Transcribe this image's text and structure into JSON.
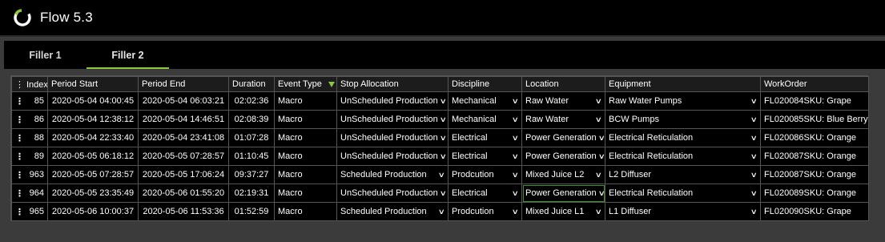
{
  "app": {
    "title": "Flow 5.3",
    "accent": "#8dc63f"
  },
  "tabs": [
    {
      "label": "Filler 1",
      "active": false
    },
    {
      "label": "Filler 2",
      "active": true
    }
  ],
  "grid": {
    "columns": [
      "Index",
      "Period Start",
      "Period End",
      "Duration",
      "Event Type",
      "Stop Allocation",
      "Discipline",
      "Location",
      "Equipment",
      "WorkOrder"
    ],
    "row_menu_glyph": "⋮",
    "rows": [
      {
        "index": "85",
        "start": "2020-05-04 04:00:45",
        "end": "2020-05-04 06:03:21",
        "duration": "02:02:36",
        "event": "Macro",
        "stop": "UnScheduled Production",
        "discipline": "Mechanical",
        "location": "Raw Water",
        "equipment": "Raw Water Pumps",
        "workorder": "FL020084SKU: Grape"
      },
      {
        "index": "86",
        "start": "2020-05-04 12:38:12",
        "end": "2020-05-04 14:46:51",
        "duration": "02:08:39",
        "event": "Macro",
        "stop": "UnScheduled Production",
        "discipline": "Mechanical",
        "location": "Raw Water",
        "equipment": "BCW Pumps",
        "workorder": "FL020085SKU: Blue Berry"
      },
      {
        "index": "88",
        "start": "2020-05-04 22:33:40",
        "end": "2020-05-04 23:41:08",
        "duration": "01:07:28",
        "event": "Macro",
        "stop": "UnScheduled Production",
        "discipline": "Electrical",
        "location": "Power Generation",
        "equipment": "Electrical Reticulation",
        "workorder": "FL020086SKU: Orange"
      },
      {
        "index": "89",
        "start": "2020-05-05 06:18:12",
        "end": "2020-05-05 07:28:57",
        "duration": "01:10:45",
        "event": "Macro",
        "stop": "UnScheduled Production",
        "discipline": "Electrical",
        "location": "Power Generation",
        "equipment": "Electrical Reticulation",
        "workorder": "FL020087SKU: Orange"
      },
      {
        "index": "963",
        "start": "2020-05-05 07:28:57",
        "end": "2020-05-05 17:06:24",
        "duration": "09:37:27",
        "event": "Macro",
        "stop": "Scheduled Production",
        "discipline": "Prodcution",
        "location": "Mixed Juice L2",
        "equipment": "L2 Diffuser",
        "workorder": "FL020087SKU: Orange"
      },
      {
        "index": "964",
        "start": "2020-05-05 23:35:49",
        "end": "2020-05-06 01:55:20",
        "duration": "02:19:31",
        "event": "Macro",
        "stop": "UnScheduled Production",
        "discipline": "Electrical",
        "location": "Power Generation",
        "equipment": "Electrical Reticulation",
        "workorder": "FL020089SKU: Orange"
      },
      {
        "index": "965",
        "start": "2020-05-06 10:00:37",
        "end": "2020-05-06 11:53:36",
        "duration": "01:52:59",
        "event": "Macro",
        "stop": "Scheduled Production",
        "discipline": "Prodcution",
        "location": "Mixed Juice L1",
        "equipment": "L1 Diffuser",
        "workorder": "FL020090SKU: Grape"
      }
    ]
  }
}
